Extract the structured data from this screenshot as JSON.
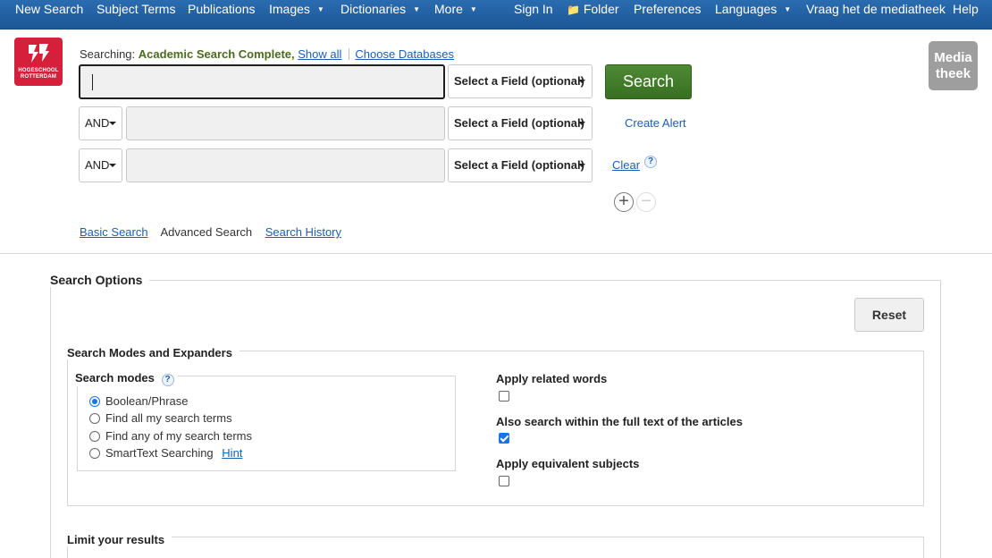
{
  "nav": {
    "new_search": "New Search",
    "subject_terms": "Subject Terms",
    "publications": "Publications",
    "images": "Images",
    "dictionaries": "Dictionaries",
    "more": "More",
    "sign_in": "Sign In",
    "folder": "Folder",
    "preferences": "Preferences",
    "languages": "Languages",
    "ask": "Vraag het de mediatheek",
    "help": "Help",
    "caret": "▼",
    "folder_icon": "📁"
  },
  "logo": {
    "line1": "HOGESCHOOL",
    "line2": "ROTTERDAM",
    "brand_color": "#d6203b"
  },
  "media_logo": {
    "line1": "Media",
    "line2": "theek"
  },
  "searching": {
    "label": "Searching:",
    "database": "Academic Search Complete,",
    "show_all": "Show all",
    "choose_databases": "Choose Databases"
  },
  "search_rows": [
    {
      "operator": "",
      "field_placeholder": "Select a Field (optional)",
      "value": ""
    },
    {
      "operator": "AND",
      "field_placeholder": "Select a Field (optional)",
      "value": ""
    },
    {
      "operator": "AND",
      "field_placeholder": "Select a Field (optional)",
      "value": ""
    }
  ],
  "actions": {
    "search": "Search",
    "create_alert": "Create Alert",
    "clear": "Clear",
    "help": "?",
    "add_row": "+",
    "remove_row": "−"
  },
  "tabs": {
    "basic": "Basic Search",
    "advanced": "Advanced Search",
    "history": "Search History"
  },
  "options": {
    "title": "Search Options",
    "reset": "Reset",
    "modes_section": "Search Modes and Expanders",
    "modes_title": "Search modes",
    "modes_help": "?",
    "modes": [
      {
        "label": "Boolean/Phrase",
        "selected": true
      },
      {
        "label": "Find all my search terms",
        "selected": false
      },
      {
        "label": "Find any of my search terms",
        "selected": false
      },
      {
        "label": "SmartText Searching",
        "selected": false
      }
    ],
    "hint": "Hint",
    "expanders": [
      {
        "label": "Apply related words",
        "checked": false
      },
      {
        "label": "Also search within the full text of the articles",
        "checked": true
      },
      {
        "label": "Apply equivalent subjects",
        "checked": false
      }
    ],
    "limit_title": "Limit your results"
  },
  "colors": {
    "nav_bg": "#1d5796",
    "search_green": "#386f22",
    "link_blue": "#1a5fb4"
  }
}
